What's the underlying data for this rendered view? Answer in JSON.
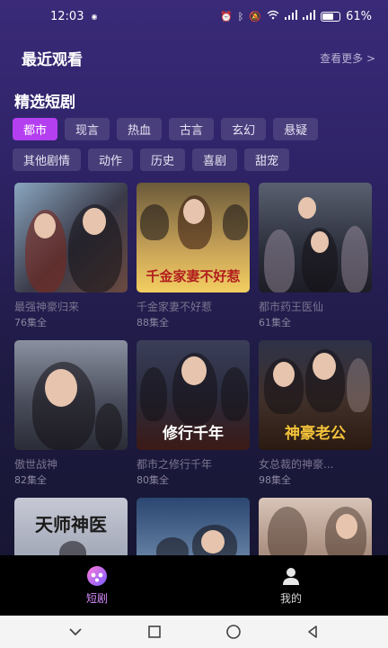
{
  "status": {
    "time": "12:03",
    "battery": "61%"
  },
  "recent": {
    "title": "最近观看",
    "see_more": "查看更多 >"
  },
  "featured": {
    "title": "精选短剧",
    "chips": [
      "都市",
      "现言",
      "热血",
      "古言",
      "玄幻",
      "悬疑",
      "其他剧情",
      "动作",
      "历史",
      "喜剧",
      "甜宠"
    ],
    "active_chip": "都市"
  },
  "dramas": [
    {
      "title": "最强神豪归来",
      "episodes": "76集全",
      "overlay": ""
    },
    {
      "title": "千金家妻不好惹",
      "episodes": "88集全",
      "overlay": "千金家妻不好惹"
    },
    {
      "title": "都市药王医仙",
      "episodes": "61集全",
      "overlay": ""
    },
    {
      "title": "傲世战神",
      "episodes": "82集全",
      "overlay": ""
    },
    {
      "title": "都市之修行千年",
      "episodes": "80集全",
      "overlay": "修行千年"
    },
    {
      "title": "女总裁的神豪...",
      "episodes": "98集全",
      "overlay": "神豪老公"
    },
    {
      "title": "",
      "episodes": "",
      "overlay": "天师神医"
    },
    {
      "title": "",
      "episodes": "",
      "overlay": ""
    },
    {
      "title": "",
      "episodes": "",
      "overlay": ""
    }
  ],
  "tabs": [
    {
      "label": "短剧",
      "icon": "drama-icon",
      "active": true
    },
    {
      "label": "我的",
      "icon": "profile-icon",
      "active": false
    }
  ],
  "colors": {
    "accent": "#b43ff0",
    "active_tab": "#d78cff"
  }
}
